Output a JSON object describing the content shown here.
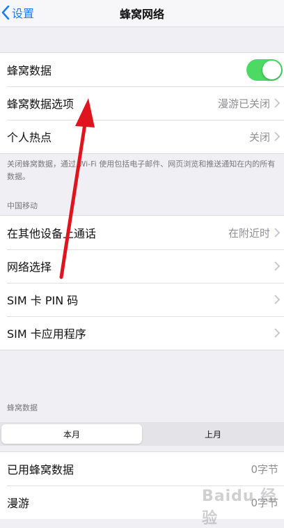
{
  "navbar": {
    "back_label": "设置",
    "title": "蜂窝网络"
  },
  "group1": {
    "rows": [
      {
        "label": "蜂窝数据",
        "toggle_on": true
      },
      {
        "label": "蜂窝数据选项",
        "value": "漫游已关闭"
      },
      {
        "label": "个人热点",
        "value": "关闭"
      }
    ]
  },
  "note": "关闭蜂窝数据，通过 Wi-Fi 使用包括电子邮件、网页浏览和推送通知在内的所有数据。",
  "carrier_section": {
    "header": "中国移动"
  },
  "group2": {
    "rows": [
      {
        "label": "在其他设备上通话",
        "value": "在附近时"
      },
      {
        "label": "网络选择",
        "value": ""
      },
      {
        "label": "SIM 卡 PIN 码",
        "value": ""
      },
      {
        "label": "SIM 卡应用程序",
        "value": ""
      }
    ]
  },
  "usage_section": {
    "header": "蜂窝数据"
  },
  "segment": {
    "options": [
      "本月",
      "上月"
    ],
    "selected": "本月"
  },
  "group3": {
    "rows": [
      {
        "label": "已用蜂窝数据",
        "value": "0字节"
      },
      {
        "label": "漫游",
        "value": "0字节"
      }
    ]
  },
  "colors": {
    "accent": "#1a7cf5",
    "toggle_on": "#4cd964",
    "annotation_arrow": "#e0141e"
  },
  "watermark": "Baidu 经验"
}
